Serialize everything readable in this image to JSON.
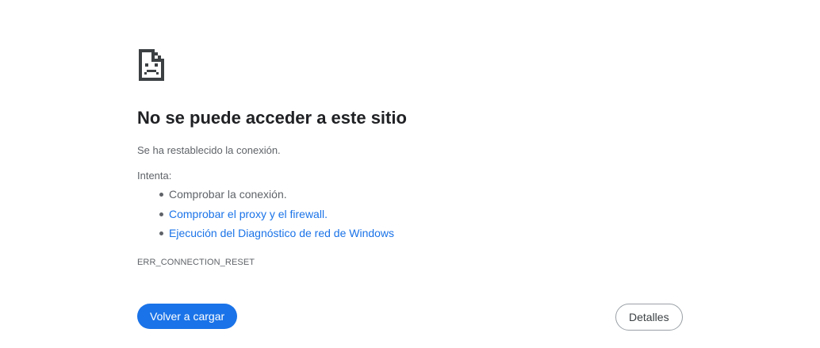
{
  "error": {
    "icon": "sad-document-icon",
    "title": "No se puede acceder a este sitio",
    "description": "Se ha restablecido la conexión.",
    "try_label": "Intenta:",
    "suggestions": [
      {
        "label": "Comprobar la conexión.",
        "is_link": false
      },
      {
        "label": "Comprobar el proxy y el firewall.",
        "is_link": true
      },
      {
        "label": "Ejecución del Diagnóstico de red de Windows",
        "is_link": true
      }
    ],
    "code": "ERR_CONNECTION_RESET"
  },
  "buttons": {
    "reload_label": "Volver a cargar",
    "details_label": "Detalles"
  },
  "colors": {
    "accent": "#1a73e8",
    "text_primary": "#202124",
    "text_secondary": "#5f6368"
  }
}
